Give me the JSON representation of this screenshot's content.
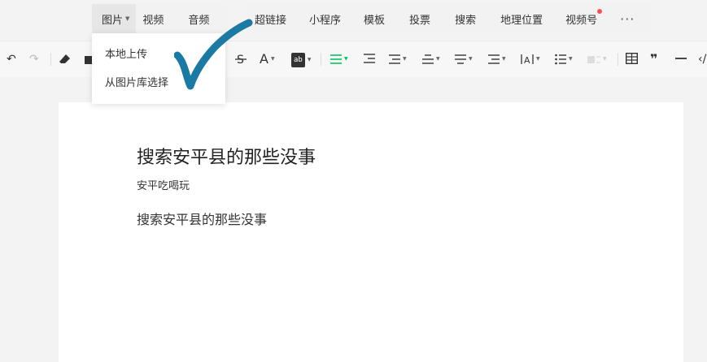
{
  "insert_bar": {
    "media": [
      {
        "label": "图片",
        "active": true
      },
      {
        "label": "视频"
      },
      {
        "label": "音频"
      }
    ],
    "items": [
      {
        "label": "超链接"
      },
      {
        "label": "小程序"
      },
      {
        "label": "模板"
      },
      {
        "label": "投票"
      },
      {
        "label": "搜索"
      },
      {
        "label": "地理位置"
      },
      {
        "label": "视频号",
        "badge_color": "#fa5151"
      }
    ],
    "more_label": "···"
  },
  "image_dropdown": {
    "items": [
      "本地上传",
      "从图片库选择"
    ]
  },
  "toolbar": {
    "undo": "↶",
    "redo": "↷",
    "font_color": "A",
    "highlight": "ab",
    "quote": "❞",
    "code": "‹/"
  },
  "document": {
    "title": "搜索安平县的那些没事",
    "author": "安平吃喝玩",
    "body": "搜索安平县的那些没事"
  },
  "colors": {
    "accent_green": "#07c160",
    "checkmark": "#1a7aa3",
    "badge_red": "#fa5151"
  }
}
